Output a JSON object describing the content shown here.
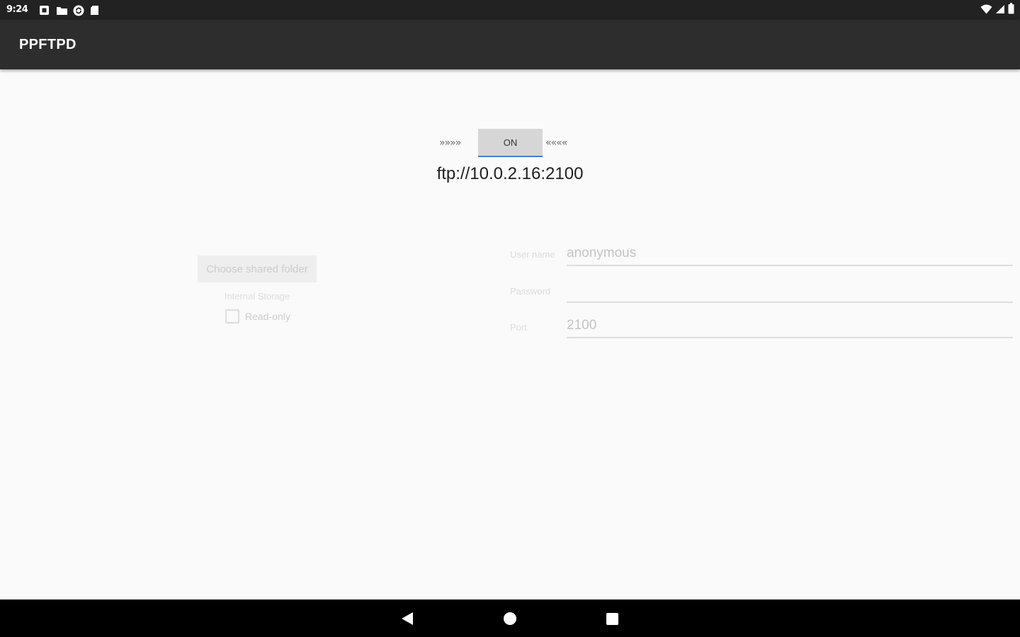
{
  "status_bar": {
    "time": "9:24",
    "notification_icons": [
      "sim-icon",
      "folder-icon",
      "sync-icon",
      "sd-card-icon"
    ],
    "system_icons": [
      "wifi-icon",
      "signal-icon",
      "battery-icon"
    ]
  },
  "app_bar": {
    "title": "PPFTPD"
  },
  "server": {
    "arrows_left": "»»»»",
    "toggle_label": "ON",
    "arrows_right": "««««",
    "url": "ftp://10.0.2.16:2100"
  },
  "folder": {
    "choose_button_label": "Choose shared folder",
    "storage_label": "Internal Storage",
    "readonly_label": "Read-only",
    "readonly_checked": false
  },
  "credentials": {
    "username_label": "User name",
    "username_value": "anonymous",
    "password_label": "Password",
    "password_value": "",
    "port_label": "Port",
    "port_value": "2100"
  },
  "colors": {
    "status_bar_bg": "#222222",
    "app_bar_bg": "#2d2d2d",
    "background": "#fafafa",
    "toggle_underline": "#4f74d9",
    "nav_bar_bg": "#000000"
  }
}
